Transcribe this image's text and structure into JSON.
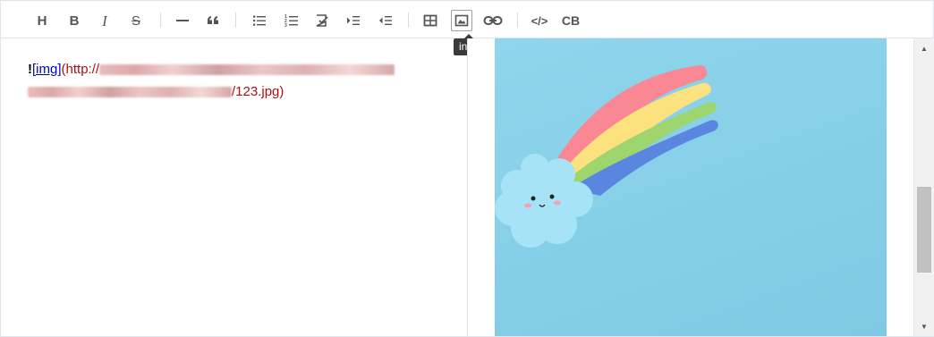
{
  "toolbar": {
    "buttons": [
      {
        "name": "heading",
        "glyph": "H"
      },
      {
        "name": "bold",
        "glyph": "B"
      },
      {
        "name": "italic",
        "glyph": "I"
      },
      {
        "name": "strikethrough",
        "glyph": "S"
      },
      {
        "name": "horizontal-rule",
        "glyph": ""
      },
      {
        "name": "quote",
        "glyph": "“"
      },
      {
        "name": "unordered-list",
        "glyph": ""
      },
      {
        "name": "ordered-list",
        "glyph": ""
      },
      {
        "name": "task-list",
        "glyph": ""
      },
      {
        "name": "indent",
        "glyph": ""
      },
      {
        "name": "outdent",
        "glyph": ""
      },
      {
        "name": "table",
        "glyph": ""
      },
      {
        "name": "insert-image",
        "glyph": ""
      },
      {
        "name": "link",
        "glyph": ""
      },
      {
        "name": "code",
        "glyph": "</>"
      },
      {
        "name": "code-block",
        "glyph": "CB"
      }
    ],
    "tooltip": "insert image"
  },
  "source": {
    "bang": "!",
    "alt_link": "[img]",
    "url_prefix": "(http://",
    "url_suffix": "/123.jpg)"
  },
  "colors": {
    "accent_link": "#0000cc",
    "url_text": "#aa1111",
    "image_sky": "#87cfe8"
  }
}
